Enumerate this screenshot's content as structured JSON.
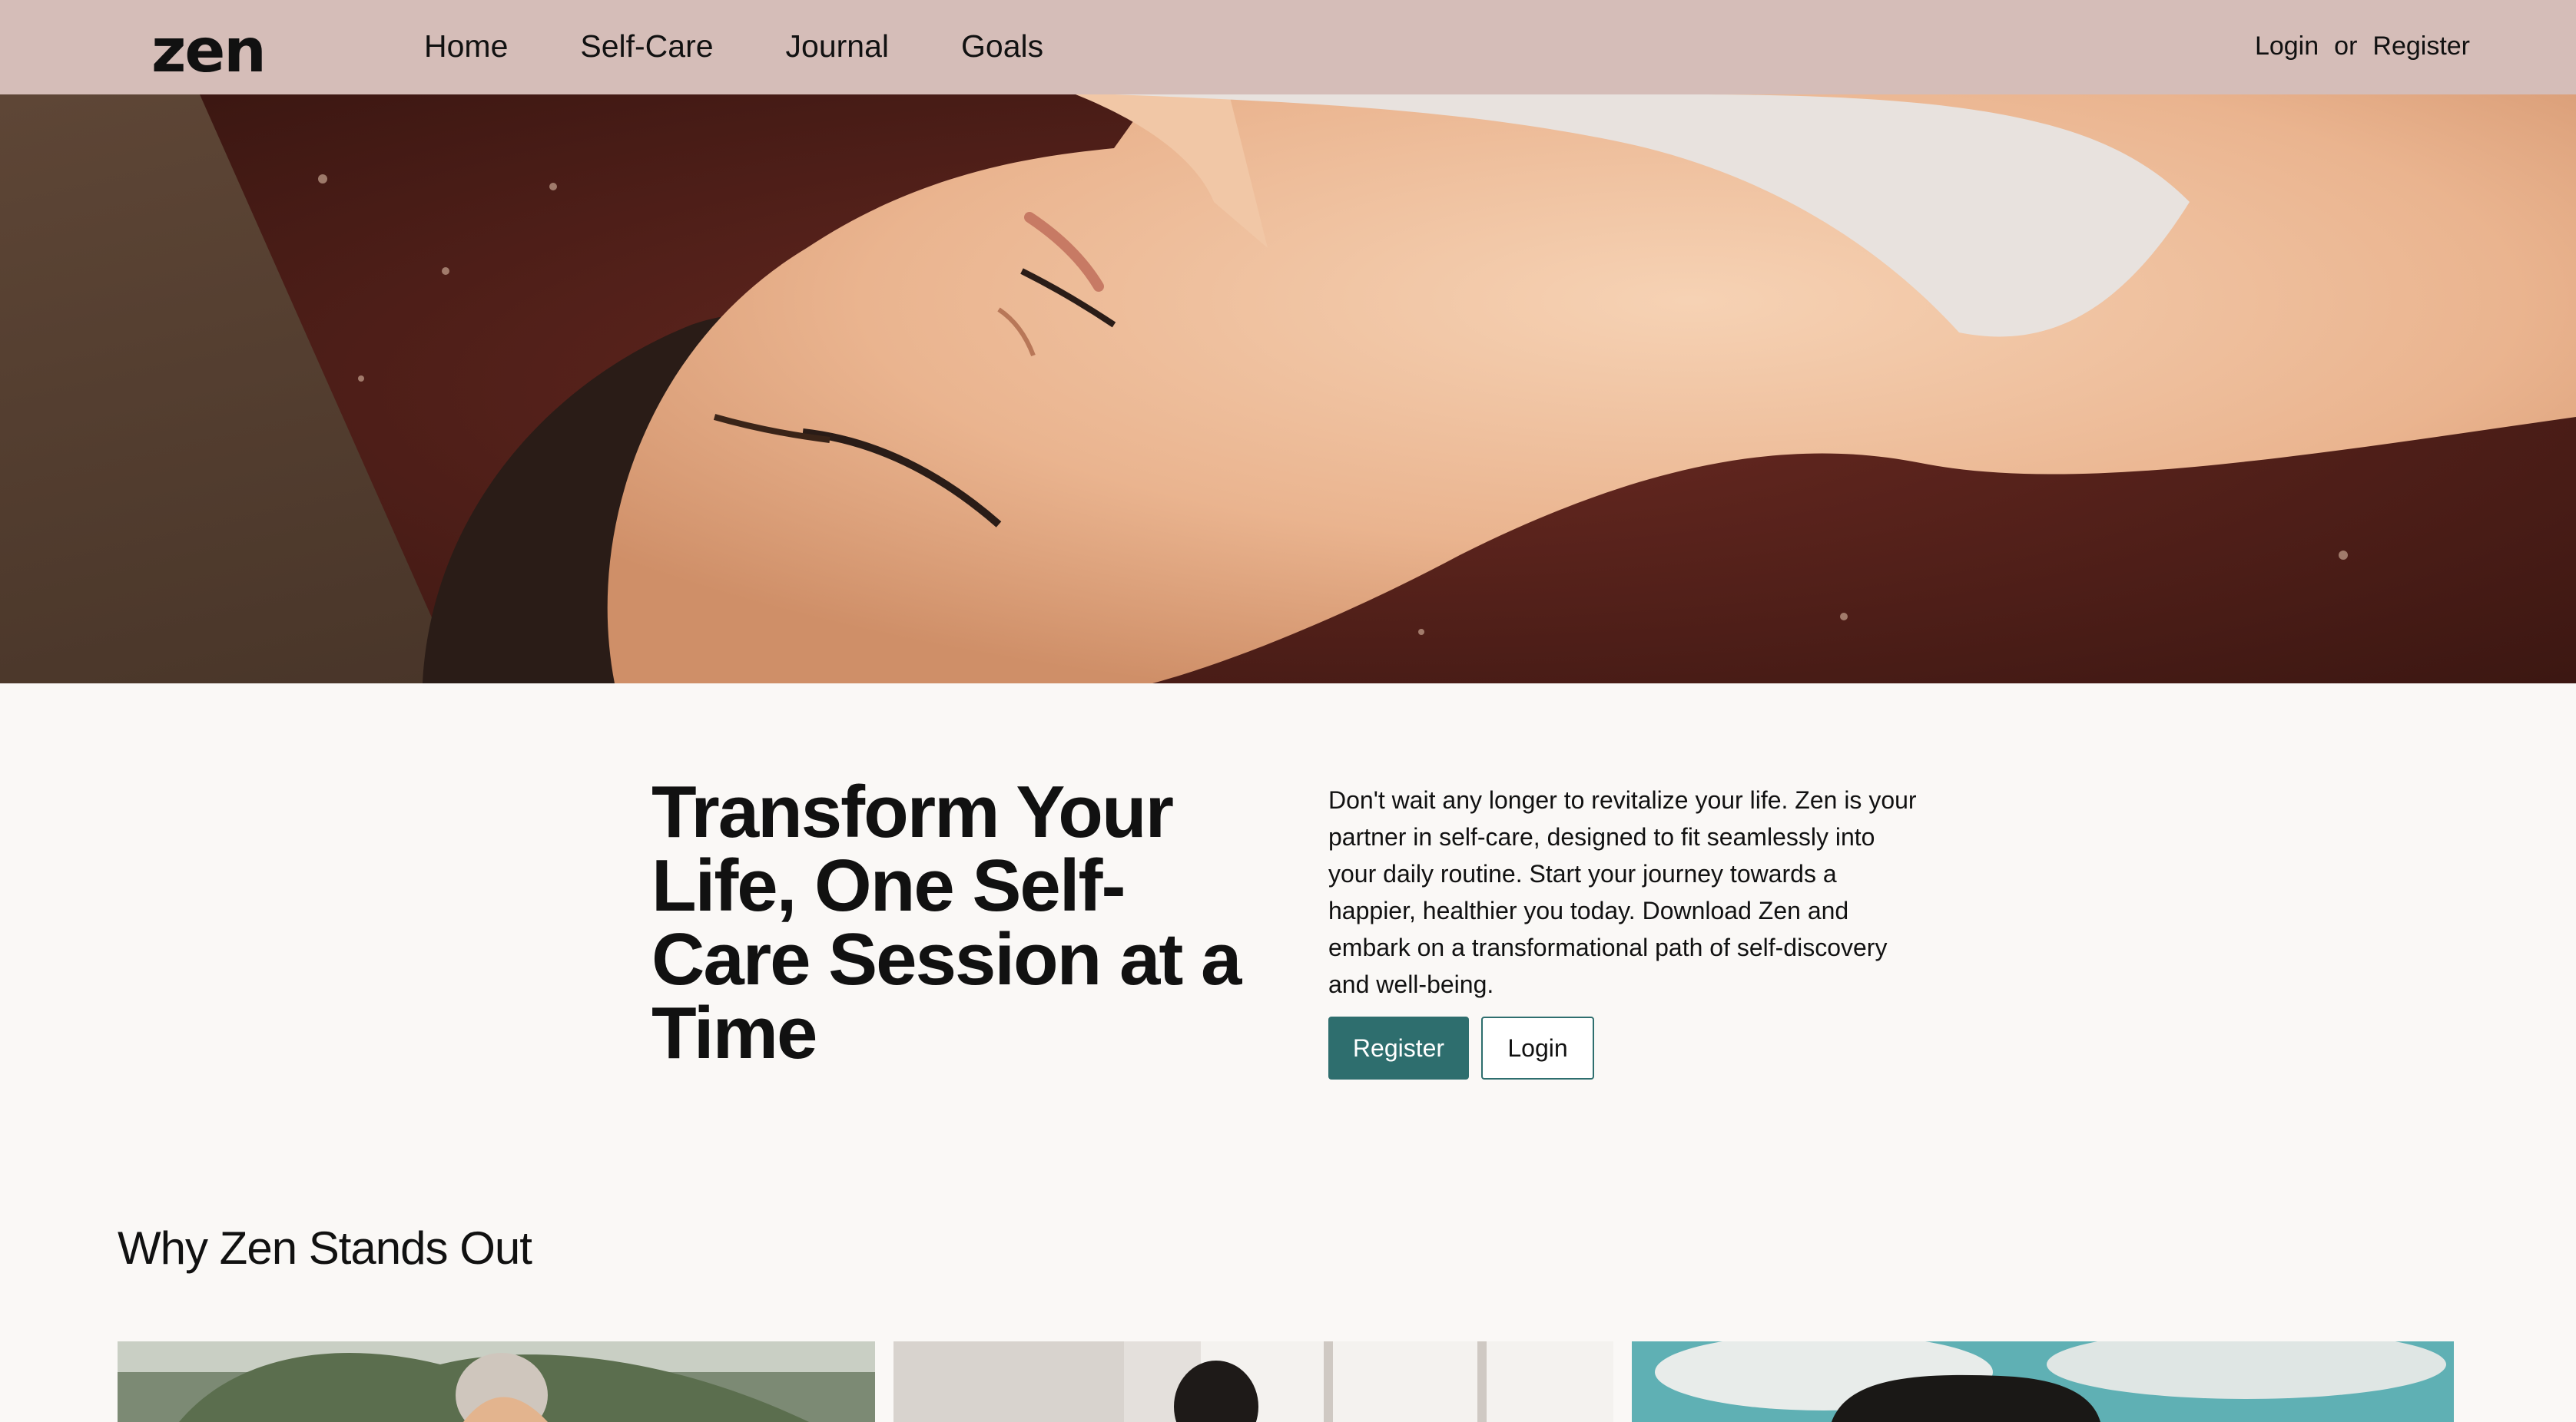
{
  "brand": {
    "logo": "zen"
  },
  "nav": {
    "items": [
      {
        "label": "Home"
      },
      {
        "label": "Self-Care"
      },
      {
        "label": "Journal"
      },
      {
        "label": "Goals"
      }
    ],
    "login": "Login",
    "separator": "or",
    "register": "Register"
  },
  "hero": {
    "image": "woman-relaxing-eyes-closed-photo"
  },
  "intro": {
    "headline": "Transform Your Life, One Self-Care Session at a Time",
    "paragraph": "Don't wait any longer to revitalize your life. Zen is your partner in self-care, designed to fit seamlessly into your daily routine. Start your journey towards a happier, healthier you today. Download Zen and embark on a transformational path of self-discovery and well-being.",
    "register_button": "Register",
    "login_button": "Login"
  },
  "features": {
    "title": "Why Zen Stands Out",
    "cards": [
      {
        "image": "woman-in-greenhouse-photo"
      },
      {
        "image": "woman-by-window-photo"
      },
      {
        "image": "person-in-cap-sky-photo"
      }
    ]
  },
  "colors": {
    "nav_background": "#d5bdb8",
    "page_background": "#faf8f6",
    "accent": "#2e6e6e"
  }
}
